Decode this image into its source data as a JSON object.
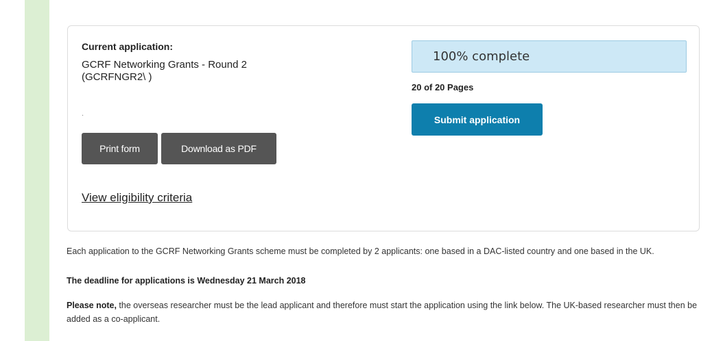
{
  "application": {
    "current_label": "Current application:",
    "name": "GCRF Networking Grants - Round 2",
    "code": "(GCRFNGR2\\       )",
    "dot": "."
  },
  "buttons": {
    "print": "Print form",
    "pdf": "Download as PDF",
    "submit": "Submit application"
  },
  "links": {
    "eligibility": "View eligibility criteria"
  },
  "progress": {
    "text": "100% complete",
    "fraction": 1.0,
    "pages": "20 of 20 Pages"
  },
  "info": {
    "paragraph1": "Each application to the GCRF Networking Grants scheme must be completed by 2 applicants: one based in a DAC-listed country and one based in the UK.",
    "deadline": "The deadline for applications is Wednesday 21 March 2018",
    "note_bold": "Please note,",
    "note_rest": " the overseas researcher must be the lead applicant and therefore must start the application using the link below. The UK-based researcher must then be added as a co-applicant."
  },
  "colors": {
    "left_bar": "#dcefd3",
    "progress_bg": "#cde8f6",
    "submit_bg": "#0e7fad",
    "dark_button": "#555555"
  }
}
